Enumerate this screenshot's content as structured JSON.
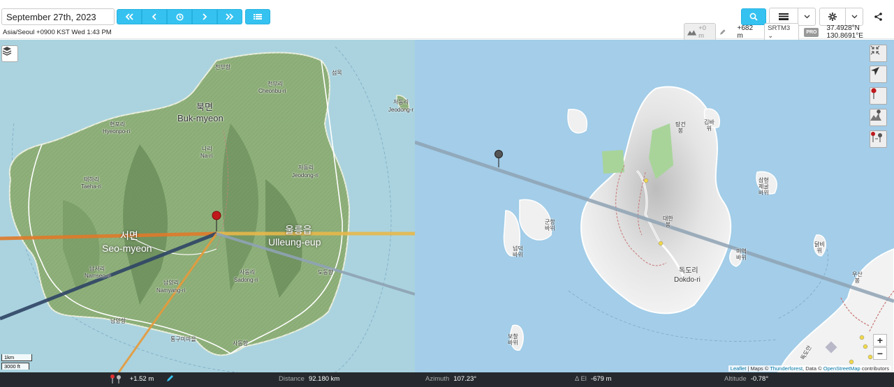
{
  "toolbar": {
    "date_value": "September 27th, 2023",
    "timezone_text": "Asia/Seoul +0900 KST Wed 1:43 PM",
    "icons": [
      "double-left-icon",
      "left-icon",
      "clock-icon",
      "right-icon",
      "double-right-icon",
      "list-icon",
      "search-icon",
      "layers-bars-icon",
      "chevron-down-icon",
      "gear-icon",
      "chevron-down-icon",
      "share-icon"
    ]
  },
  "info": {
    "offset": "+0 m",
    "elevation": "+682 m",
    "dem": "SRTM3",
    "pro_badge": "PRO",
    "coords": "37.4928°N 130.8691°E"
  },
  "left_map": {
    "labels": {
      "cheonbu_hang": "천부항",
      "cheonbu_ko": "천부리",
      "cheonbu_en": "Cheonbu-ri",
      "seommok": "섬목",
      "buk_ko": "북면",
      "buk_en": "Buk-myeon",
      "hyeonpo_ko": "현포리",
      "hyeonpo_en": "Hyeonpo-ri",
      "nari_ko": "나리",
      "nari_en": "Na-ri",
      "taeha_ko": "태하리",
      "taeha_en": "Taeha-ri",
      "jeodong_ko": "저동리",
      "jeodong_en": "Jeodong-ri",
      "jeodong2_ko": "저동리",
      "jeodong2_en": "Jeodong-r",
      "seo_ko": "서면",
      "seo_en": "Seo-myeon",
      "ulleung_ko": "울릉읍",
      "ulleung_en": "Ulleung-eup",
      "namseo_ko": "남서리",
      "namseo_en": "Namseo-ri",
      "namyang_ko": "남양리",
      "namyang_en": "Namyang-ri",
      "sadong_ko": "사동리",
      "sadong_en": "Sadong-ri",
      "dodong": "도동항",
      "namyanghang": "남양항",
      "tonggumi": "통구미마을",
      "sadonghang": "사동항"
    },
    "scale_km": "1km",
    "scale_ft": "3000 ft"
  },
  "right_map": {
    "labels": {
      "tangeon": "탕건\n봉",
      "gimba": "김바\n위",
      "gunham": "군함\n바위",
      "daehan": "대한\n봉",
      "dokdo_ko": "독도리",
      "dokdo_en": "Dokdo-ri",
      "samhyeong": "삼형\n제굴\n바위",
      "miyeok": "미역\n바위",
      "neopdeok": "넙덕\n바위",
      "dalbi": "닭비\n위",
      "usan": "우산\n봉",
      "bochal": "보찰\n바위",
      "dokdoan": "독도안"
    },
    "attribution": {
      "leaflet": "Leaflet",
      "maps": "| Maps ©",
      "thunderforest": "Thunderforest",
      "data": ", Data ©",
      "osm": "OpenStreetMap",
      "contributors": "contributors"
    },
    "zoom_in": "+",
    "zoom_out": "−"
  },
  "status": {
    "elev_diff": "+1.52 m",
    "distance_label": "Distance",
    "distance_value": "92.180 km",
    "azimuth_label": "Azimuth",
    "azimuth_value": "107.23°",
    "el_label": "Δ El",
    "el_value": "-679 m",
    "alt_label": "Altitude",
    "alt_value": "-0.78°"
  },
  "colors": {
    "accent": "#35c2f0",
    "sea": "#aad3df",
    "land": "#8fb07a",
    "sunrise_line": "#e07a2a",
    "sun_line": "#e8b84a",
    "moon_line": "#2f4566",
    "target_line": "#8fa3b4",
    "status_bg": "#262a2e"
  }
}
